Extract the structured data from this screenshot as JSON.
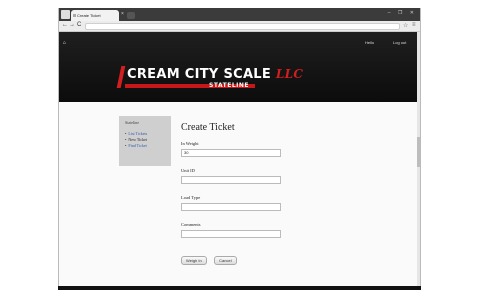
{
  "browser": {
    "tab_title": "Create Ticket",
    "tab_close": "×",
    "window_controls": "– ❐ ✕",
    "nav": {
      "back": "←",
      "forward": "→",
      "reload": "C"
    },
    "tool_icons": {
      "star": "☆",
      "menu": "≡"
    }
  },
  "header": {
    "home_icon": "🏠",
    "links": [
      "Hello",
      "Log out"
    ]
  },
  "logo": {
    "main": "CREAM CITY SCALE",
    "script": "LLC",
    "sub": "STATELINE",
    "colors": {
      "accent": "#d21e1e",
      "background": "#111111"
    }
  },
  "sidebar": {
    "title": "Stateline",
    "items": [
      {
        "label": "List Tickets",
        "active": false
      },
      {
        "label": "New Ticket",
        "active": true
      },
      {
        "label": "Find Ticket",
        "active": false
      }
    ]
  },
  "form": {
    "title": "Create Ticket",
    "fields": [
      {
        "label": "In Weight",
        "value": "30"
      },
      {
        "label": "Unit ID",
        "value": ""
      },
      {
        "label": "Load Type",
        "value": ""
      },
      {
        "label": "Comments",
        "value": ""
      }
    ],
    "buttons": {
      "weigh_in": "Weigh In",
      "cancel": "Cancel"
    }
  }
}
